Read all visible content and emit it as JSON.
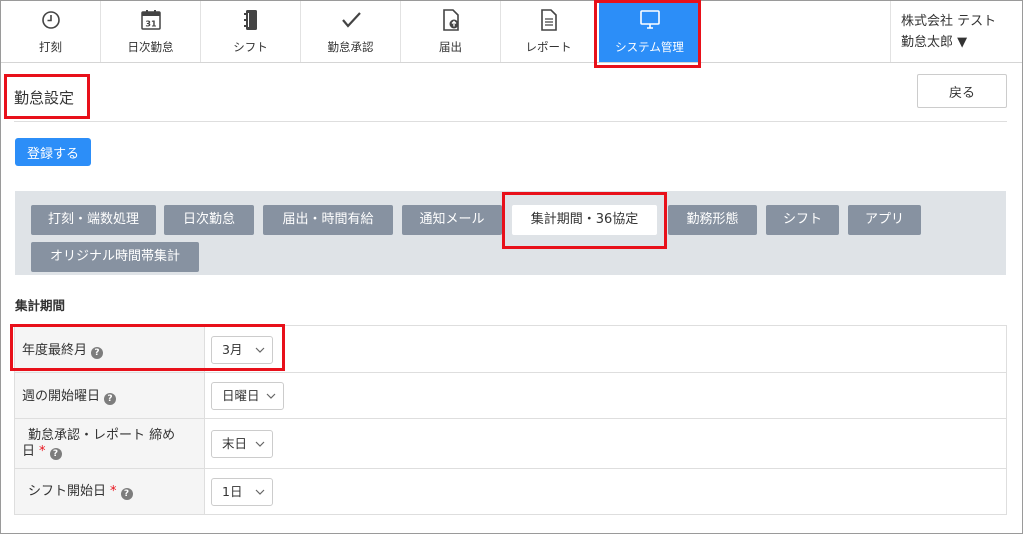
{
  "nav": {
    "items": [
      {
        "label": "打刻",
        "icon": "clock-icon"
      },
      {
        "label": "日次勤怠",
        "icon": "calendar-icon"
      },
      {
        "label": "シフト",
        "icon": "notebook-icon"
      },
      {
        "label": "勤怠承認",
        "icon": "checkmark-icon"
      },
      {
        "label": "届出",
        "icon": "document-upload-icon"
      },
      {
        "label": "レポート",
        "icon": "report-icon"
      },
      {
        "label": "システム管理",
        "icon": "monitor-icon"
      }
    ],
    "calendar_day": "31",
    "active_index": 6
  },
  "user": {
    "company": "株式会社 テスト",
    "name": "勤怠太郎 ▼"
  },
  "page": {
    "title": "勤怠設定",
    "back_label": "戻る",
    "save_label": "登録する"
  },
  "tabs": [
    {
      "label": "打刻・端数処理"
    },
    {
      "label": "日次勤怠"
    },
    {
      "label": "届出・時間有給"
    },
    {
      "label": "通知メール"
    },
    {
      "label": "集計期間・36協定"
    },
    {
      "label": "勤務形態"
    },
    {
      "label": "シフト"
    },
    {
      "label": "アプリ"
    },
    {
      "label": "オリジナル時間帯集計"
    }
  ],
  "section": {
    "title": "集計期間",
    "rows": [
      {
        "label": "年度最終月",
        "required": false,
        "value": "3月"
      },
      {
        "label": "週の開始曜日",
        "required": false,
        "value": "日曜日"
      },
      {
        "label_line1": "勤怠承認・レポート 締め",
        "label_line2": "日",
        "required": true,
        "value": "末日"
      },
      {
        "label": "シフト開始日",
        "required": true,
        "value": "1日"
      }
    ],
    "required_mark": "*",
    "help_mark": "?"
  },
  "colors": {
    "accent": "#2c8ef8",
    "highlight": "#e8101a",
    "tab_inactive": "#8792a1",
    "tab_area": "#dfe3e7"
  }
}
